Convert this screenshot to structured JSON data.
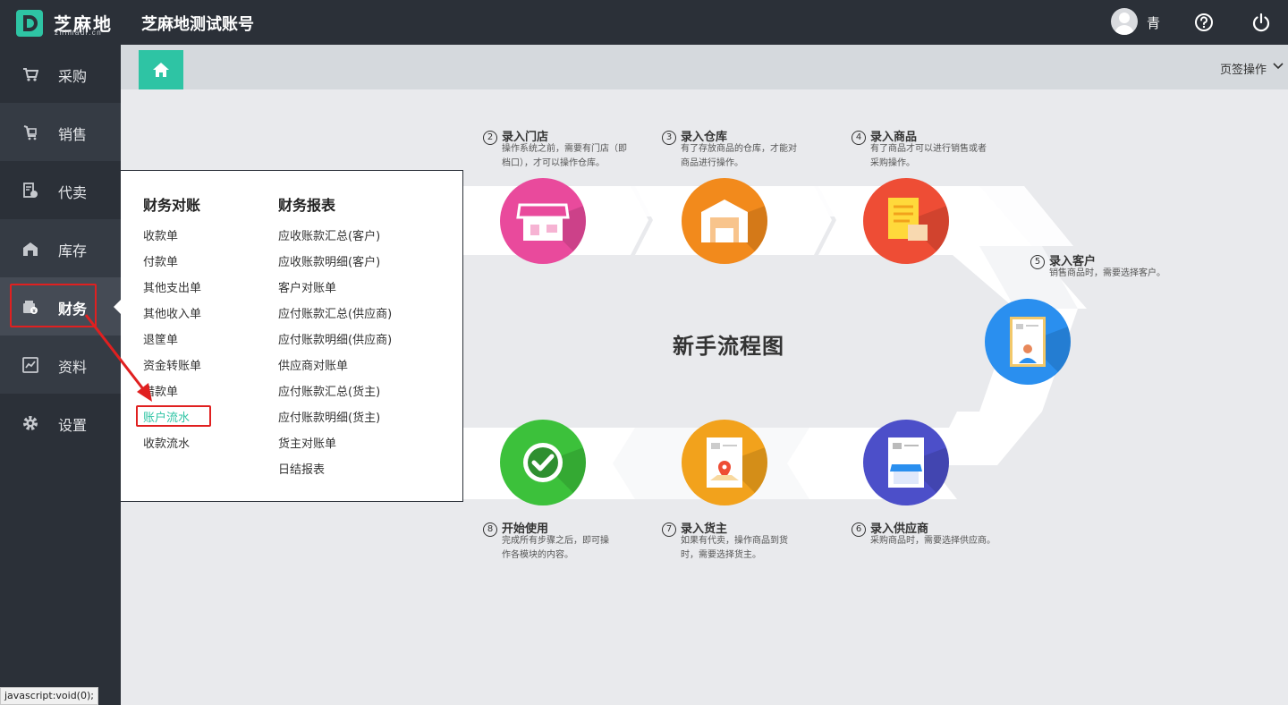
{
  "header": {
    "logo_cn": "芝麻地",
    "logo_en": "zhimadi.cn",
    "account_title": "芝麻地测试账号",
    "user_name": "青"
  },
  "sidebar": {
    "items": [
      {
        "label": "采购",
        "icon": "cart-icon"
      },
      {
        "label": "销售",
        "icon": "sales-icon"
      },
      {
        "label": "代卖",
        "icon": "consign-icon"
      },
      {
        "label": "库存",
        "icon": "warehouse-icon"
      },
      {
        "label": "财务",
        "icon": "finance-icon",
        "active": true
      },
      {
        "label": "资料",
        "icon": "data-icon"
      },
      {
        "label": "设置",
        "icon": "gear-icon"
      }
    ]
  },
  "tabbar": {
    "home_icon": "home-icon",
    "ops_label": "页签操作"
  },
  "dropdown": {
    "col1": {
      "title": "财务对账",
      "items": [
        "收款单",
        "付款单",
        "其他支出单",
        "其他收入单",
        "退筐单",
        "资金转账单",
        "借款单",
        "账户流水",
        "收款流水"
      ]
    },
    "col2": {
      "title": "财务报表",
      "items": [
        "应收账款汇总(客户)",
        "应收账款明细(客户)",
        "客户对账单",
        "应付账款汇总(供应商)",
        "应付账款明细(供应商)",
        "供应商对账单",
        "应付账款汇总(货主)",
        "应付账款明细(货主)",
        "货主对账单",
        "日结报表"
      ]
    },
    "selected_item": "账户流水"
  },
  "flow": {
    "title": "新手流程图",
    "steps": [
      {
        "num": "2",
        "title": "录入门店",
        "desc": [
          "操作系统之前，需要有门店（即",
          "档口），才可以操作仓库。"
        ],
        "color": "#e94a9c"
      },
      {
        "num": "3",
        "title": "录入仓库",
        "desc": [
          "有了存放商品的仓库，才能对",
          "商品进行操作。"
        ],
        "color": "#f28a1c"
      },
      {
        "num": "4",
        "title": "录入商品",
        "desc": [
          "有了商品才可以进行销售或者",
          "采购操作。"
        ],
        "color": "#ee4d35"
      },
      {
        "num": "5",
        "title": "录入客户",
        "desc": [
          "销售商品时，需要选择客户。"
        ],
        "color": "#2a8fef"
      },
      {
        "num": "6",
        "title": "录入供应商",
        "desc": [
          "采购商品时，需要选择供应商。"
        ],
        "color": "#4c4fc9"
      },
      {
        "num": "7",
        "title": "录入货主",
        "desc": [
          "如果有代卖，操作商品到货",
          "时，需要选择货主。"
        ],
        "color": "#f2a21c"
      },
      {
        "num": "8",
        "title": "开始使用",
        "desc": [
          "完成所有步骤之后，即可操",
          "作各模块的内容。"
        ],
        "color": "#3cc13b"
      }
    ]
  },
  "status_bar": "javascript:void(0);"
}
